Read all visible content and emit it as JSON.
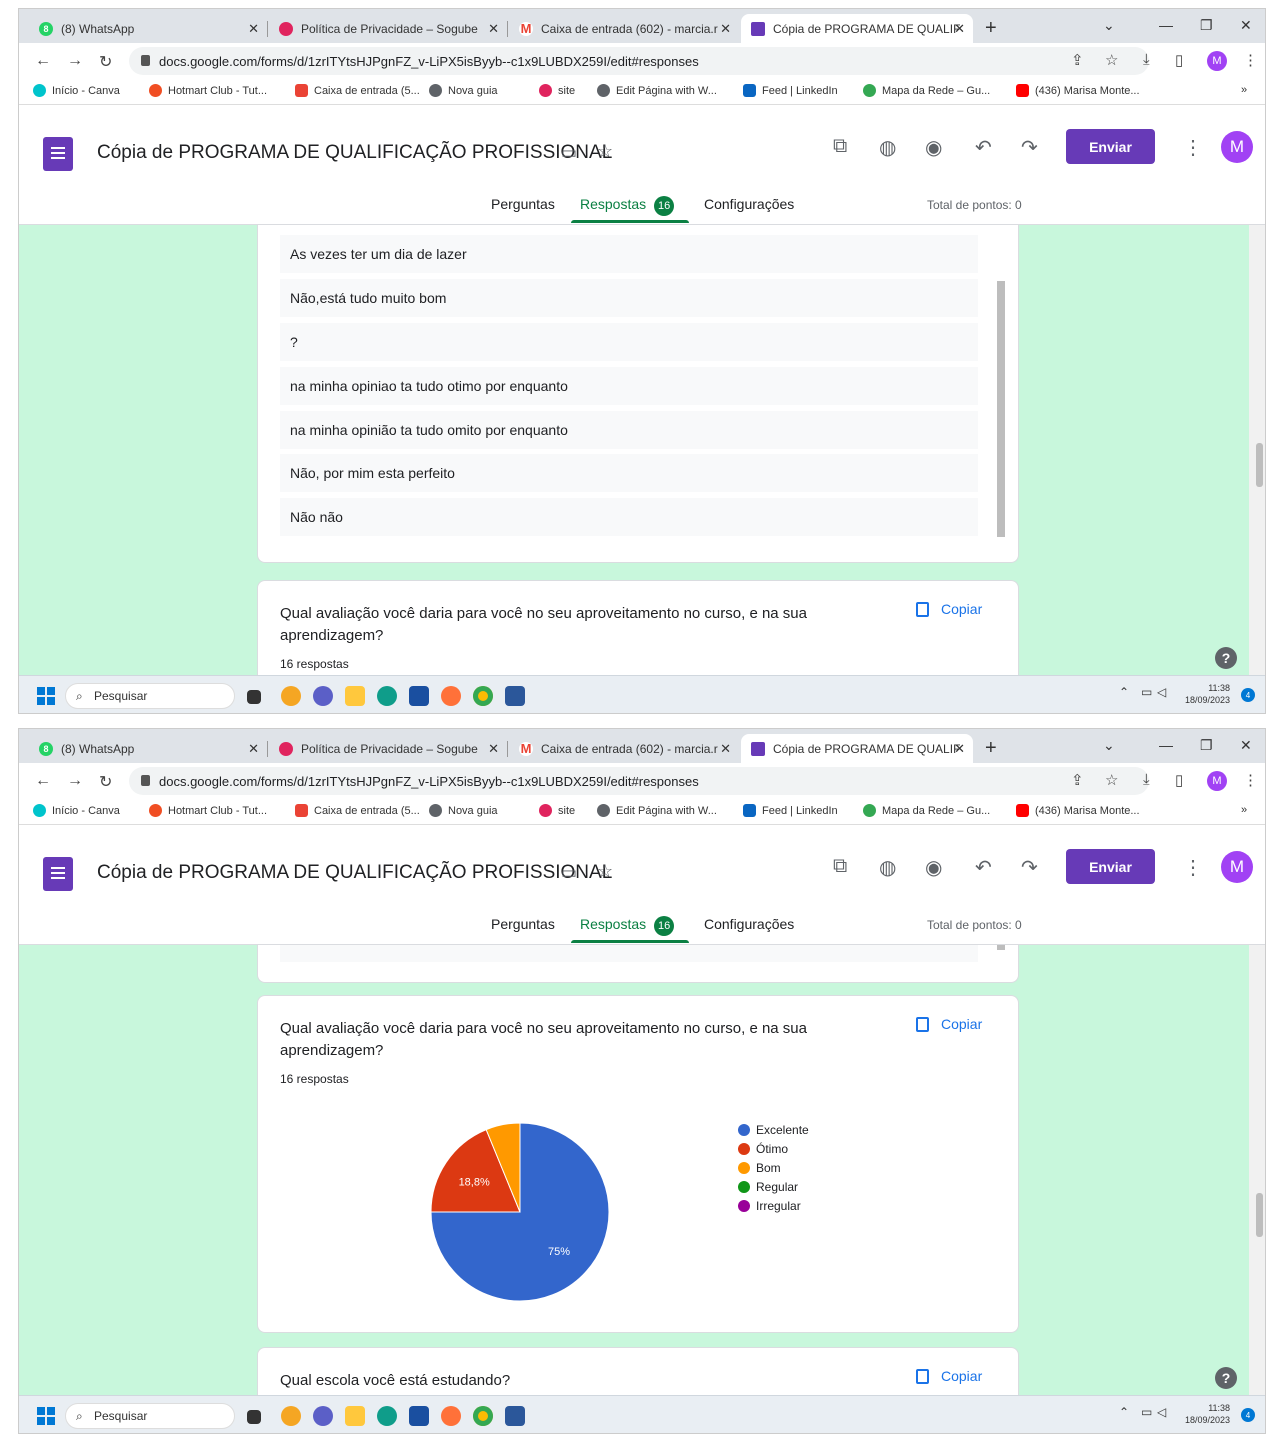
{
  "browser": {
    "tabs": [
      {
        "label": "(8) WhatsApp",
        "icon": "whatsapp-icon",
        "badge": "8"
      },
      {
        "label": "Política de Privacidade – Sogube",
        "icon": "heart-icon"
      },
      {
        "label": "Caixa de entrada (602) - marcia.r",
        "icon": "gmail-icon"
      },
      {
        "label": "Cópia de PROGRAMA DE QUALIF",
        "icon": "forms-icon"
      }
    ],
    "url": "docs.google.com/forms/d/1zrITYtsHJPgnFZ_v-LiPX5isByyb--c1x9LUBDX259I/edit#responses",
    "bookmarks": [
      "Início - Canva",
      "Hotmart Club - Tut...",
      "Caixa de entrada (5...",
      "Nova guia",
      "site",
      "Edit Página with W...",
      "Feed | LinkedIn",
      "Mapa da Rede – Gu...",
      "(436) Marisa Monte..."
    ],
    "profile_initial": "M",
    "more_bookmarks": "»"
  },
  "form": {
    "title": "Cópia de PROGRAMA DE QUALIFICAÇÃO PROFISSIONAL",
    "send_label": "Enviar",
    "avatar": "M",
    "tabs": {
      "questions": "Perguntas",
      "responses": "Respostas",
      "responses_count": "16",
      "settings": "Configurações"
    },
    "total_points": "Total de pontos: 0"
  },
  "answers": [
    "As vezes ter um dia de lazer",
    "Não,está tudo muito bom",
    "?",
    "na minha opiniao ta tudo otimo por enquanto",
    "na minha opinião ta tudo omito por enquanto",
    "Não, por mim esta perfeito",
    "Não não"
  ],
  "question_rating": {
    "text": "Qual avaliação você daria para você no seu aproveitamento no curso, e na sua aprendizagem?",
    "count": "16 respostas",
    "copy_label": "Copiar"
  },
  "question_school": {
    "text": "Qual escola você está estudando?",
    "copy_label": "Copiar"
  },
  "chart_data": {
    "type": "pie",
    "categories": [
      "Excelente",
      "Ótimo",
      "Bom",
      "Regular",
      "Irregular"
    ],
    "values": [
      75,
      18.8,
      6.2,
      0,
      0
    ],
    "labels": [
      "75%",
      "18,8%",
      "",
      "",
      ""
    ],
    "colors": [
      "#3366cc",
      "#dc3912",
      "#ff9900",
      "#109618",
      "#990099"
    ],
    "legend_position": "right"
  },
  "taskbar": {
    "search_placeholder": "Pesquisar",
    "time": "11:38",
    "date": "18/09/2023",
    "notification_count": "4"
  },
  "help_label": "?"
}
